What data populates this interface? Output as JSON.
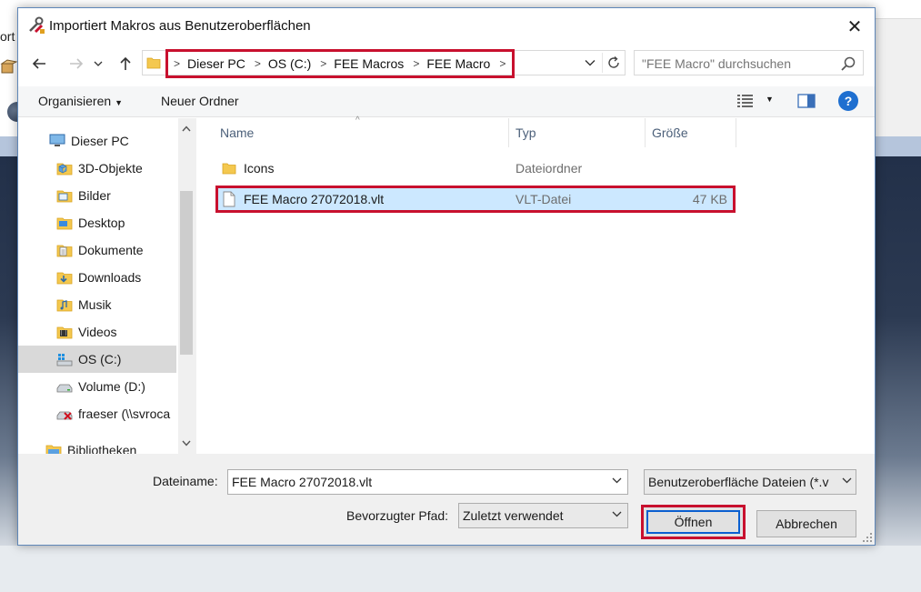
{
  "background": {
    "partial_text": "ort"
  },
  "dialog": {
    "title": "Importiert Makros aus Benutzeroberflächen",
    "close_glyph": "✕"
  },
  "navigation": {
    "breadcrumb": [
      "Dieser PC",
      "OS (C:)",
      "FEE Macros",
      "FEE Macro"
    ],
    "search_placeholder": "\"FEE Macro\" durchsuchen"
  },
  "toolbar": {
    "organize_label": "Organisieren",
    "new_folder_label": "Neuer Ordner",
    "help_label": "?"
  },
  "nav_pane": {
    "items": [
      {
        "label": "Dieser PC",
        "icon": "computer-icon"
      },
      {
        "label": "3D-Objekte",
        "icon": "3d-objects-icon"
      },
      {
        "label": "Bilder",
        "icon": "pictures-icon"
      },
      {
        "label": "Desktop",
        "icon": "desktop-icon"
      },
      {
        "label": "Dokumente",
        "icon": "documents-icon"
      },
      {
        "label": "Downloads",
        "icon": "downloads-icon"
      },
      {
        "label": "Musik",
        "icon": "music-icon"
      },
      {
        "label": "Videos",
        "icon": "videos-icon"
      },
      {
        "label": "OS (C:)",
        "icon": "windows-drive-icon",
        "selected": true
      },
      {
        "label": "Volume (D:)",
        "icon": "drive-icon"
      },
      {
        "label": "fraeser (\\\\svroca",
        "icon": "network-drive-disconnected-icon"
      },
      {
        "label": "Bibliotheken",
        "icon": "libraries-icon"
      }
    ]
  },
  "file_list": {
    "columns": {
      "name": "Name",
      "type": "Typ",
      "size": "Größe"
    },
    "rows": [
      {
        "name": "Icons",
        "type": "Dateiordner",
        "size": "",
        "icon": "folder-icon"
      },
      {
        "name": "FEE Macro 27072018.vlt",
        "type": "VLT-Datei",
        "size": "47 KB",
        "icon": "file-icon",
        "selected": true
      }
    ]
  },
  "bottom": {
    "filename_label": "Dateiname:",
    "filename_value": "FEE Macro 27072018.vlt",
    "filter_value": "Benutzeroberfläche Dateien (*.v",
    "path_label": "Bevorzugter Pfad:",
    "path_value": "Zuletzt verwendet",
    "open_label": "Öffnen",
    "cancel_label": "Abbrechen"
  },
  "colors": {
    "highlight_red": "#c8102e",
    "selection_blue": "#cce8ff",
    "focus_blue": "#0a5fd0",
    "help_blue": "#1e6fd0"
  }
}
